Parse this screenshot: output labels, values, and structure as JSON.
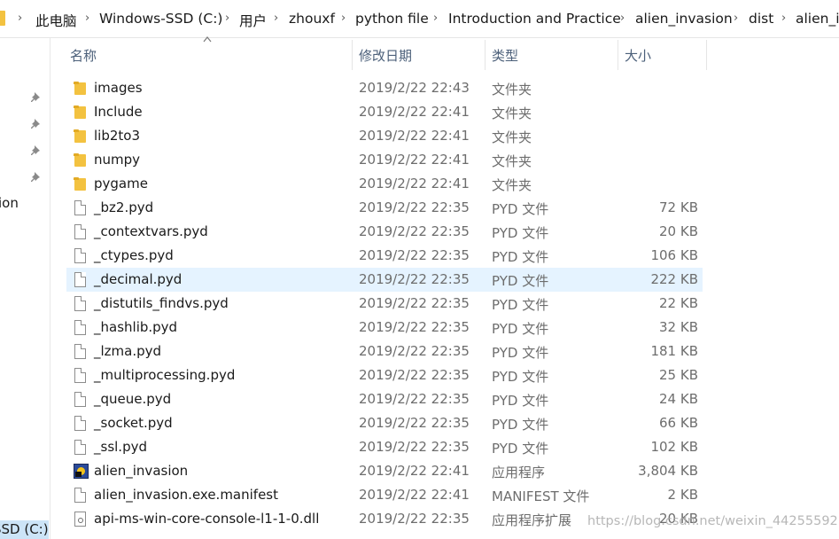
{
  "breadcrumb": [
    "此电脑",
    "Windows-SSD (C:)",
    "用户",
    "zhouxf",
    "python file",
    "Introduction and Practice",
    "alien_invasion",
    "dist",
    "alien_in"
  ],
  "nav": {
    "quick_access_fragment": "ion",
    "drive_label": "SSD (C:)"
  },
  "columns": {
    "name": "名称",
    "date": "修改日期",
    "type": "类型",
    "size": "大小"
  },
  "files": [
    {
      "name": "images",
      "date": "2019/2/22 22:43",
      "type": "文件夹",
      "size": "",
      "icon": "folder-icon"
    },
    {
      "name": "Include",
      "date": "2019/2/22 22:41",
      "type": "文件夹",
      "size": "",
      "icon": "folder-icon"
    },
    {
      "name": "lib2to3",
      "date": "2019/2/22 22:41",
      "type": "文件夹",
      "size": "",
      "icon": "folder-icon"
    },
    {
      "name": "numpy",
      "date": "2019/2/22 22:41",
      "type": "文件夹",
      "size": "",
      "icon": "folder-icon"
    },
    {
      "name": "pygame",
      "date": "2019/2/22 22:41",
      "type": "文件夹",
      "size": "",
      "icon": "folder-icon"
    },
    {
      "name": "_bz2.pyd",
      "date": "2019/2/22 22:35",
      "type": "PYD 文件",
      "size": "72 KB",
      "icon": "file-icon"
    },
    {
      "name": "_contextvars.pyd",
      "date": "2019/2/22 22:35",
      "type": "PYD 文件",
      "size": "20 KB",
      "icon": "file-icon"
    },
    {
      "name": "_ctypes.pyd",
      "date": "2019/2/22 22:35",
      "type": "PYD 文件",
      "size": "106 KB",
      "icon": "file-icon"
    },
    {
      "name": "_decimal.pyd",
      "date": "2019/2/22 22:35",
      "type": "PYD 文件",
      "size": "222 KB",
      "icon": "file-icon",
      "selected": true
    },
    {
      "name": "_distutils_findvs.pyd",
      "date": "2019/2/22 22:35",
      "type": "PYD 文件",
      "size": "22 KB",
      "icon": "file-icon"
    },
    {
      "name": "_hashlib.pyd",
      "date": "2019/2/22 22:35",
      "type": "PYD 文件",
      "size": "32 KB",
      "icon": "file-icon"
    },
    {
      "name": "_lzma.pyd",
      "date": "2019/2/22 22:35",
      "type": "PYD 文件",
      "size": "181 KB",
      "icon": "file-icon"
    },
    {
      "name": "_multiprocessing.pyd",
      "date": "2019/2/22 22:35",
      "type": "PYD 文件",
      "size": "25 KB",
      "icon": "file-icon"
    },
    {
      "name": "_queue.pyd",
      "date": "2019/2/22 22:35",
      "type": "PYD 文件",
      "size": "24 KB",
      "icon": "file-icon"
    },
    {
      "name": "_socket.pyd",
      "date": "2019/2/22 22:35",
      "type": "PYD 文件",
      "size": "66 KB",
      "icon": "file-icon"
    },
    {
      "name": "_ssl.pyd",
      "date": "2019/2/22 22:35",
      "type": "PYD 文件",
      "size": "102 KB",
      "icon": "file-icon"
    },
    {
      "name": "alien_invasion",
      "date": "2019/2/22 22:41",
      "type": "应用程序",
      "size": "3,804 KB",
      "icon": "app-icon"
    },
    {
      "name": "alien_invasion.exe.manifest",
      "date": "2019/2/22 22:41",
      "type": "MANIFEST 文件",
      "size": "2 KB",
      "icon": "file-icon"
    },
    {
      "name": "api-ms-win-core-console-l1-1-0.dll",
      "date": "2019/2/22 22:35",
      "type": "应用程序扩展",
      "size": "20 KB",
      "icon": "dll-icon"
    }
  ],
  "watermark": "https://blog.csdn.net/weixin_44255592",
  "colors": {
    "selection": "#e5f3ff",
    "drive_highlight": "#cce4f7",
    "header_text": "#4c607a",
    "folder": "#f3c240"
  }
}
